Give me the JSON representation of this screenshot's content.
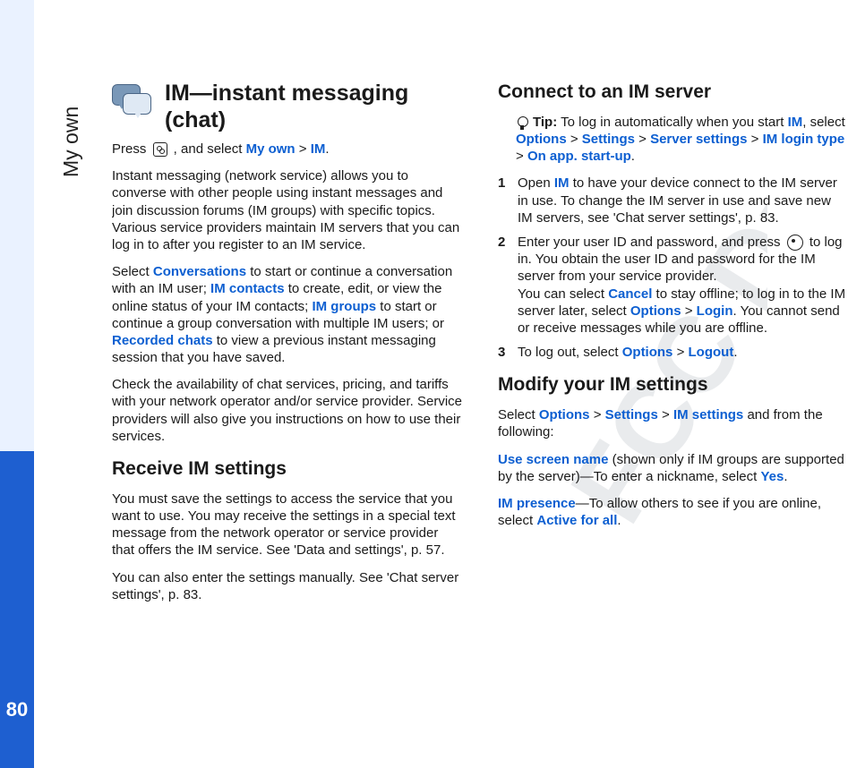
{
  "page_number": "80",
  "side_tab": "My own",
  "watermark": "FCC Draft",
  "h1": "IM—instant messaging (chat)",
  "p1a": "Press ",
  "p1b": " , and select ",
  "p1c": "My own",
  "p1d": " > ",
  "p1e": "IM",
  "p1f": ".",
  "p2": "Instant messaging (network service) allows you to converse with other people using instant messages and join discussion forums (IM groups) with specific topics. Various service providers maintain IM servers that you can log in to after you register to an IM service.",
  "p3a": "Select ",
  "p3b": "Conversations",
  "p3c": " to start or continue a conversation with an IM user; ",
  "p3d": "IM contacts",
  "p3e": " to create, edit, or view the online status of your IM contacts; ",
  "p3f": "IM groups",
  "p3g": " to start or continue a group conversation with multiple IM users; or ",
  "p3h": "Recorded chats",
  "p3i": " to view a previous instant messaging session that you have saved.",
  "p4": "Check the availability of chat services, pricing, and tariffs with your network operator and/or service provider. Service providers will also give you instructions on how to use their services.",
  "h2a": "Receive IM settings",
  "p5": "You must save the settings to access the service that you want to use. You may receive the settings in a special text message from the network operator or service provider that offers the IM service. See 'Data and settings', p. 57.",
  "p6": "You can also enter the settings manually. See 'Chat server settings', p. 83.",
  "h2b": "Connect to an IM server",
  "tip_lead": "Tip:",
  "tip_a": " To log in automatically when you start ",
  "tip_b": "IM",
  "tip_c": ", select ",
  "tip_d": "Options",
  "tip_e": " > ",
  "tip_f": "Settings",
  "tip_g": " > ",
  "tip_h": "Server settings",
  "tip_i": " > ",
  "tip_j": "IM login type",
  "tip_k": " > ",
  "tip_l": "On app. start-up",
  "tip_m": ".",
  "s1n": "1",
  "s1a": "Open ",
  "s1b": "IM",
  "s1c": " to have your device connect to the IM server in use. To change the IM server in use and save new IM servers, see 'Chat server settings', p. 83.",
  "s2n": "2",
  "s2a": "Enter your user ID and password, and press ",
  "s2b": " to log in. You obtain the user ID and password for the IM server from your service provider.",
  "s2c": "You can select ",
  "s2d": "Cancel",
  "s2e": " to stay offline; to log in to the IM server later, select ",
  "s2f": "Options",
  "s2g": " > ",
  "s2h": "Login",
  "s2i": ". You cannot send or receive messages while you are offline.",
  "s3n": "3",
  "s3a": "To log out, select ",
  "s3b": "Options",
  "s3c": " > ",
  "s3d": "Logout",
  "s3e": ".",
  "h2c": "Modify your IM settings",
  "p7a": "Select ",
  "p7b": "Options",
  "p7c": " > ",
  "p7d": "Settings",
  "p7e": " > ",
  "p7f": "IM settings",
  "p7g": " and from the following:",
  "p8a": "Use screen name",
  "p8b": " (shown only if IM groups are supported by the server)—To enter a nickname, select ",
  "p8c": "Yes",
  "p8d": ".",
  "p9a": "IM presence",
  "p9b": "—To allow others to see if you are online, select ",
  "p9c": "Active for all",
  "p9d": "."
}
